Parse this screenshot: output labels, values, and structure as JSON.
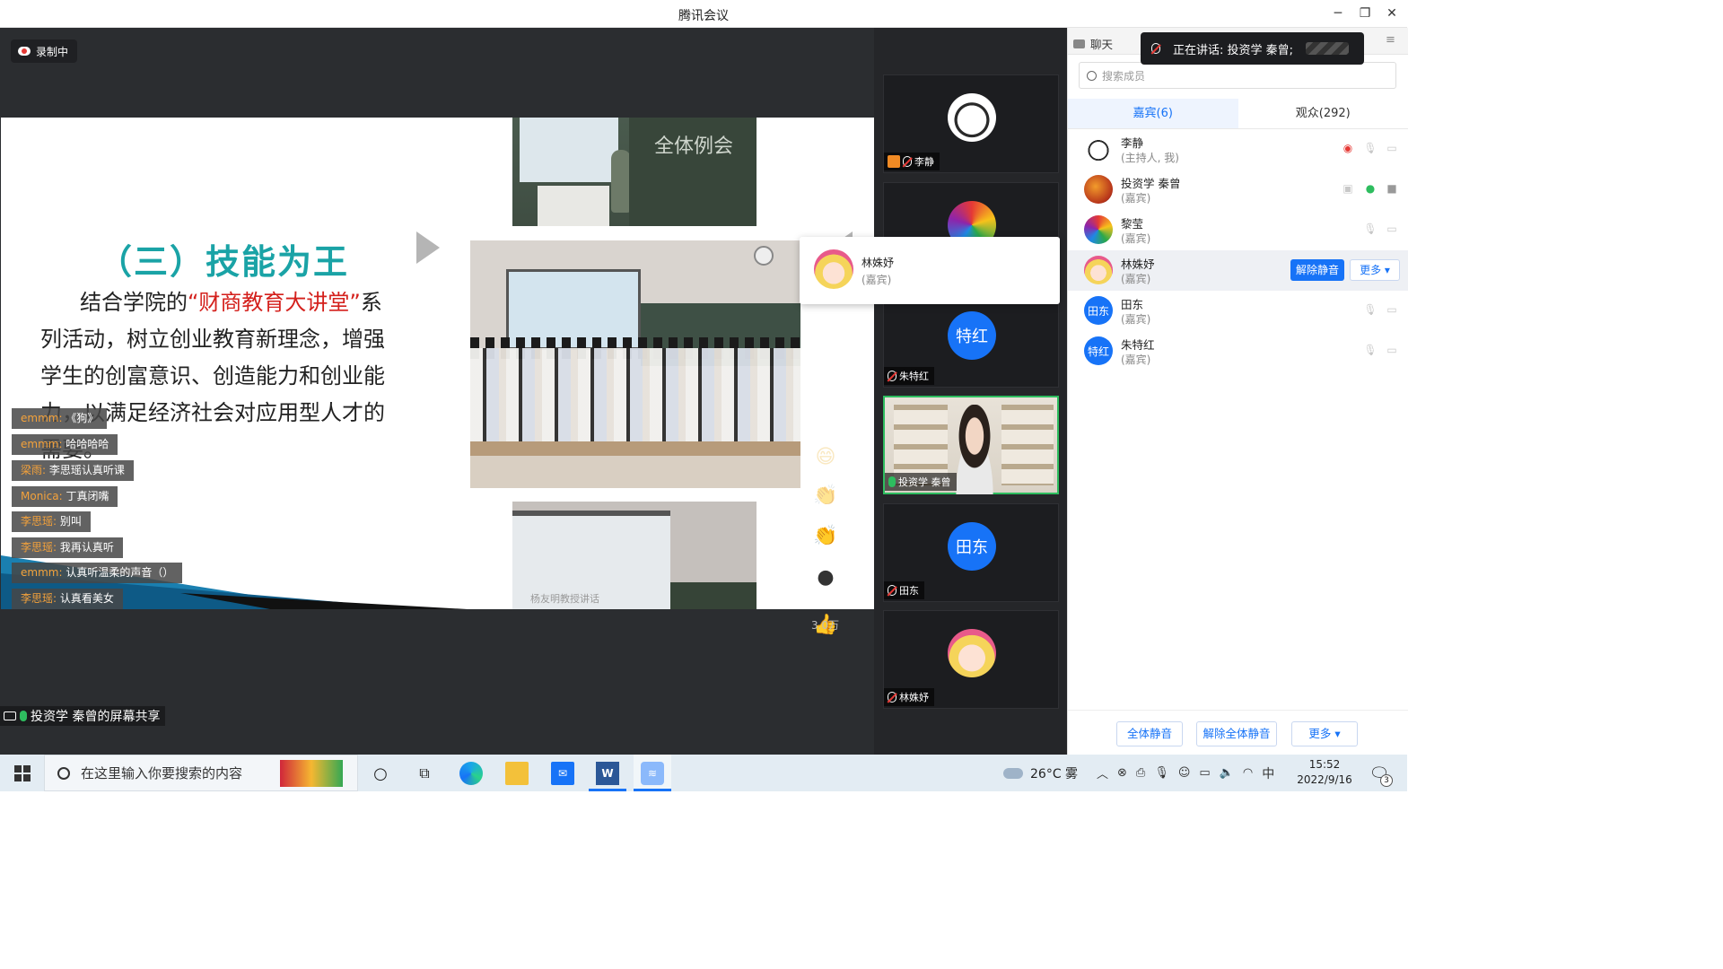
{
  "window": {
    "title": "腾讯会议"
  },
  "recording": {
    "label": "录制中"
  },
  "slide": {
    "title": "（三）技能为王",
    "body_prefix": "结合学院的",
    "body_highlight": "“财商教育大讲堂”",
    "body_rest": "系列活动，树立创业教育新理念，增强学生的创富意识、创造能力和创业能力，以满足经济社会对应用型人才的需要。",
    "photo_top_caption": "全体例会",
    "photo_bot_caption": "杨友明教授讲话"
  },
  "danmaku": [
    {
      "user": "emmm:",
      "text": "《狗》"
    },
    {
      "user": "emmm:",
      "text": "哈哈哈哈"
    },
    {
      "user": "梁雨:",
      "text": "李思瑶认真听课"
    },
    {
      "user": "Monica:",
      "text": "丁真闭嘴"
    },
    {
      "user": "李思瑶:",
      "text": "别叫"
    },
    {
      "user": "李思瑶:",
      "text": "我再认真听"
    },
    {
      "user": "emmm:",
      "text": "认真听温柔的声音（）"
    },
    {
      "user": "李思瑶:",
      "text": "认真看美女"
    }
  ],
  "reactions": {
    "count": "3.0万"
  },
  "share": {
    "label": "投资学 秦曾的屏幕共享"
  },
  "tiles": [
    {
      "name": "李静"
    },
    {
      "name": "黎莹"
    },
    {
      "name": "朱特红",
      "avatar_text": "特红"
    },
    {
      "name": "投资学 秦曾"
    },
    {
      "name": "田东",
      "avatar_text": "田东"
    },
    {
      "name": "林姝妤"
    }
  ],
  "popup": {
    "name": "林姝妤",
    "role": "(嘉宾)"
  },
  "panel": {
    "tab_chat": "聊天",
    "search_placeholder": "搜索成员",
    "tab_guests": "嘉宾(6)",
    "tab_audience": "观众(292)",
    "members": [
      {
        "name": "李静",
        "role": "(主持人, 我)"
      },
      {
        "name": "投资学 秦曾",
        "role": "(嘉宾)"
      },
      {
        "name": "黎莹",
        "role": "(嘉宾)"
      },
      {
        "name": "林姝妤",
        "role": "(嘉宾)"
      },
      {
        "name": "田东",
        "role": "(嘉宾)",
        "avatar_text": "田东"
      },
      {
        "name": "朱特红",
        "role": "(嘉宾)",
        "avatar_text": "特红"
      }
    ],
    "unmute_label": "解除静音",
    "more_label": "更多 ▾",
    "footer": {
      "mute_all": "全体静音",
      "unmute_all": "解除全体静音",
      "more": "更多 ▾"
    }
  },
  "speaking": {
    "text": "正在讲话: 投资学 秦曾;"
  },
  "taskbar": {
    "search_placeholder": "在这里输入你要搜索的内容",
    "weather": "26°C 雾",
    "ime": "中",
    "time": "15:52",
    "date": "2022/9/16",
    "notif_count": "3"
  },
  "colors": {
    "accent": "#1773f7",
    "speaking_green": "#2ebd5f",
    "slide_title": "#1aa3a6",
    "highlight_red": "#d4201c"
  }
}
